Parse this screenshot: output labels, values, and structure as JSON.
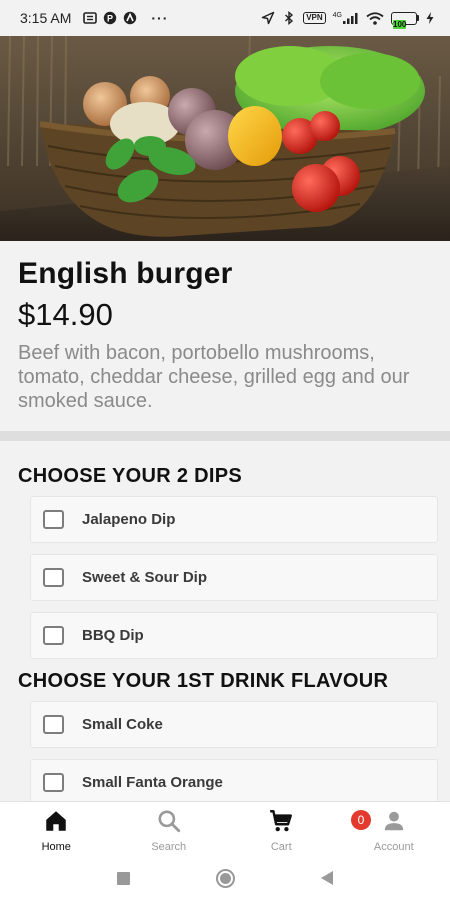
{
  "status_bar": {
    "time": "3:15 AM",
    "more": "···",
    "vpn": "VPN",
    "network": "4G",
    "battery": "100",
    "icons": [
      "news-icon",
      "p-icon",
      "a-icon",
      "location-arrow-icon",
      "bluetooth-icon",
      "signal-icon",
      "wifi-icon",
      "charging-icon"
    ]
  },
  "hero_image": {
    "alt": "vegetables-basket-photo"
  },
  "product": {
    "title": "English burger",
    "price": "$14.90",
    "description": "Beef with bacon, portobello mushrooms, tomato, cheddar cheese, grilled egg and our smoked sauce."
  },
  "sections": [
    {
      "title": "CHOOSE YOUR 2 DIPS",
      "options": [
        "Jalapeno Dip",
        "Sweet & Sour Dip",
        "BBQ Dip"
      ]
    },
    {
      "title": "CHOOSE YOUR 1ST DRINK FLAVOUR",
      "options": [
        "Small Coke",
        "Small Fanta Orange"
      ]
    }
  ],
  "bottom_nav": {
    "items": [
      {
        "label": "Home",
        "icon": "home-icon",
        "active": true
      },
      {
        "label": "Search",
        "icon": "search-icon",
        "active": false
      },
      {
        "label": "Cart",
        "icon": "cart-icon",
        "active": false
      },
      {
        "label": "Account",
        "icon": "account-icon",
        "active": false
      }
    ],
    "cart_count": "0"
  },
  "colors": {
    "background": "#f2f2f2",
    "badge": "#e23a2e",
    "battery": "#4cd437",
    "muted_text": "#8a8a8a"
  }
}
